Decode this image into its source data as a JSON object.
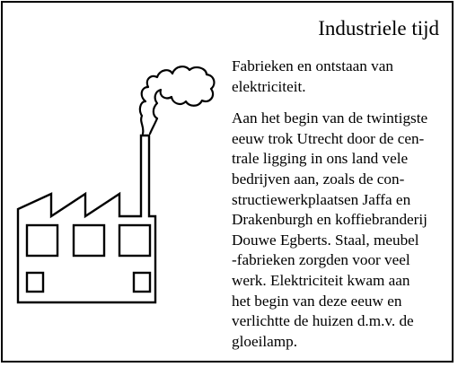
{
  "card": {
    "title": "Industriele tijd",
    "intro": "Fabrieken en  ontstaan van\nelektriciteit.",
    "body": "Aan het begin van de twintigste\neeuw trok Utrecht door de cen-\ntrale ligging in ons land vele\nbedrijven aan, zoals de con-\nstructiewerkplaatsen Jaffa en\nDrakenburgh en koffiebranderij\nDouwe Egberts. Staal, meubel\n-fabrieken zorgden voor veel\nwerk. Elektriciteit kwam aan\nhet begin van deze eeuw en\nverlichtte de huizen d.m.v. de\ngloeilamp.",
    "illustration": "factory-icon",
    "colors": {
      "ink": "#000000",
      "background": "#ffffff"
    }
  }
}
